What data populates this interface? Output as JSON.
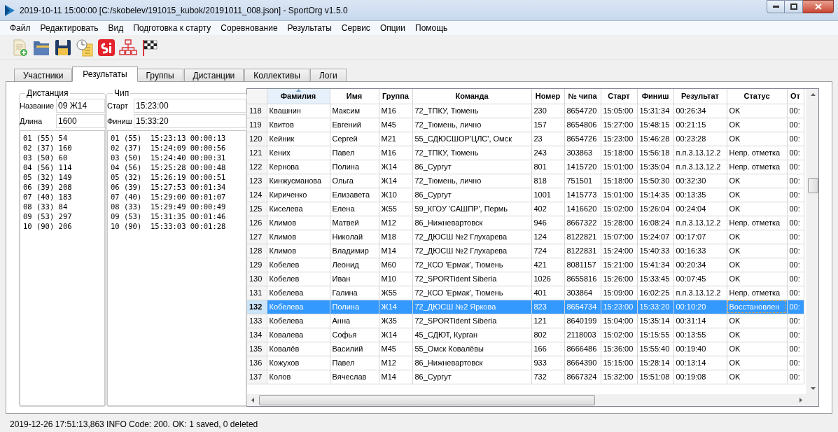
{
  "window": {
    "title": "2019-10-11 15:00:00 [C:/skobelev/191015_kubok/20191011_008.json] - SportOrg v1.5.0"
  },
  "menu": [
    "Файл",
    "Редактировать",
    "Вид",
    "Подготовка к старту",
    "Соревнование",
    "Результаты",
    "Сервис",
    "Опции",
    "Помощь"
  ],
  "tabs": [
    {
      "label": "Участники",
      "selected": false
    },
    {
      "label": "Результаты",
      "selected": true
    },
    {
      "label": "Группы",
      "selected": false
    },
    {
      "label": "Дистанции",
      "selected": false
    },
    {
      "label": "Коллективы",
      "selected": false
    },
    {
      "label": "Логи",
      "selected": false
    }
  ],
  "distance": {
    "legend": "Дистанция",
    "fields": [
      {
        "label": "Название",
        "value": "09 Ж14"
      },
      {
        "label": "Длина",
        "value": "1600"
      }
    ],
    "splits": [
      "01 (55) 54",
      "02 (37) 160",
      "03 (50) 60",
      "04 (56) 114",
      "05 (32) 149",
      "06 (39) 208",
      "07 (40) 183",
      "08 (33) 84",
      "09 (53) 297",
      "10 (90) 206"
    ]
  },
  "chip": {
    "legend": "Чип",
    "fields": [
      {
        "label": "Старт",
        "value": "15:23:00"
      },
      {
        "label": "Финиш",
        "value": "15:33:20"
      }
    ],
    "splits": [
      "01 (55)  15:23:13 00:00:13",
      "02 (37)  15:24:09 00:00:56",
      "03 (50)  15:24:40 00:00:31",
      "04 (56)  15:25:28 00:00:48",
      "05 (32)  15:26:19 00:00:51",
      "06 (39)  15:27:53 00:01:34",
      "07 (40)  15:29:00 00:01:07",
      "08 (33)  15:29:49 00:00:49",
      "09 (53)  15:31:35 00:01:46",
      "10 (90)  15:33:03 00:01:28"
    ]
  },
  "table": {
    "columns": [
      {
        "label": "Фамилия",
        "sorted": true
      },
      {
        "label": "Имя",
        "sorted": false
      },
      {
        "label": "Группа",
        "sorted": false
      },
      {
        "label": "Команда",
        "sorted": false
      },
      {
        "label": "Номер",
        "sorted": false
      },
      {
        "label": "№ чипа",
        "sorted": false
      },
      {
        "label": "Старт",
        "sorted": false
      },
      {
        "label": "Финиш",
        "sorted": false
      },
      {
        "label": "Результат",
        "sorted": false
      },
      {
        "label": "Статус",
        "sorted": false
      },
      {
        "label": "От",
        "sorted": false
      }
    ],
    "rows": [
      {
        "number": "118",
        "selected": false,
        "cells": [
          "Квашнин",
          "Максим",
          "М16",
          "72_ТПКУ, Тюмень",
          "230",
          "8654720",
          "15:05:00",
          "15:31:34",
          "00:26:34",
          "OK",
          "00:"
        ]
      },
      {
        "number": "119",
        "selected": false,
        "cells": [
          "Квитов",
          "Евгений",
          "М45",
          "72_Тюмень, лично",
          "157",
          "8654806",
          "15:27:00",
          "15:48:15",
          "00:21:15",
          "OK",
          "00:"
        ]
      },
      {
        "number": "120",
        "selected": false,
        "cells": [
          "Кейник",
          "Сергей",
          "М21",
          "55_СДЮСШОР'ЦЛС', Омск",
          "23",
          "8654726",
          "15:23:00",
          "15:46:28",
          "00:23:28",
          "OK",
          "00:"
        ]
      },
      {
        "number": "121",
        "selected": false,
        "cells": [
          "Кених",
          "Павел",
          "М16",
          "72_ТПКУ, Тюмень",
          "243",
          "303863",
          "15:18:00",
          "15:56:18",
          "п.п.3.13.12.2",
          "Непр. отметка",
          "00:"
        ]
      },
      {
        "number": "122",
        "selected": false,
        "cells": [
          "Кернова",
          "Полина",
          "Ж14",
          "86_Сургут",
          "801",
          "1415720",
          "15:01:00",
          "15:35:04",
          "п.п.3.13.12.2",
          "Непр. отметка",
          "00:"
        ]
      },
      {
        "number": "123",
        "selected": false,
        "cells": [
          "Кинжусманова",
          "Ольга",
          "Ж14",
          "72_Тюмень, лично",
          "818",
          "751501",
          "15:18:00",
          "15:50:30",
          "00:32:30",
          "OK",
          "00:"
        ]
      },
      {
        "number": "124",
        "selected": false,
        "cells": [
          "Кириченко",
          "Елизавета",
          "Ж10",
          "86_Сургут",
          "1001",
          "1415773",
          "15:01:00",
          "15:14:35",
          "00:13:35",
          "OK",
          "00:"
        ]
      },
      {
        "number": "125",
        "selected": false,
        "cells": [
          "Киселева",
          "Елена",
          "Ж55",
          "59_КГОУ 'САШПР', Пермь",
          "402",
          "1416620",
          "15:02:00",
          "15:26:04",
          "00:24:04",
          "OK",
          "00:"
        ]
      },
      {
        "number": "126",
        "selected": false,
        "cells": [
          "Климов",
          "Матвей",
          "М12",
          "86_Нижневартовск",
          "946",
          "8667322",
          "15:28:00",
          "16:08:24",
          "п.п.3.13.12.2",
          "Непр. отметка",
          "00:"
        ]
      },
      {
        "number": "127",
        "selected": false,
        "cells": [
          "Климов",
          "Николай",
          "М18",
          "72_ДЮСШ №2  Глухарева",
          "124",
          "8122821",
          "15:07:00",
          "15:24:07",
          "00:17:07",
          "OK",
          "00:"
        ]
      },
      {
        "number": "128",
        "selected": false,
        "cells": [
          "Климов",
          "Владимир",
          "М14",
          "72_ДЮСШ №2  Глухарева",
          "724",
          "8122831",
          "15:24:00",
          "15:40:33",
          "00:16:33",
          "OK",
          "00:"
        ]
      },
      {
        "number": "129",
        "selected": false,
        "cells": [
          "Кобелев",
          "Леонид",
          "М60",
          "72_КСО 'Ермак', Тюмень",
          "421",
          "8081157",
          "15:21:00",
          "15:41:34",
          "00:20:34",
          "OK",
          "00:"
        ]
      },
      {
        "number": "130",
        "selected": false,
        "cells": [
          "Кобелев",
          "Иван",
          "М10",
          "72_SPORTident Siberia",
          "1026",
          "8655816",
          "15:26:00",
          "15:33:45",
          "00:07:45",
          "OK",
          "00:"
        ]
      },
      {
        "number": "131",
        "selected": false,
        "cells": [
          "Кобелева",
          "Галина",
          "Ж55",
          "72_КСО 'Ермак', Тюмень",
          "401",
          "303864",
          "15:09:00",
          "16:02:25",
          "п.п.3.13.12.2",
          "Непр. отметка",
          "00:"
        ]
      },
      {
        "number": "132",
        "selected": true,
        "cells": [
          "Кобелева",
          "Полина",
          "Ж14",
          "72_ДЮСШ №2 Яркова",
          "823",
          "8654734",
          "15:23:00",
          "15:33:20",
          "00:10:20",
          "Восстановлен",
          "00:"
        ]
      },
      {
        "number": "133",
        "selected": false,
        "cells": [
          "Кобелева",
          "Анна",
          "Ж35",
          "72_SPORTident Siberia",
          "121",
          "8640199",
          "15:04:00",
          "15:35:14",
          "00:31:14",
          "OK",
          "00:"
        ]
      },
      {
        "number": "134",
        "selected": false,
        "cells": [
          "Ковалева",
          "Софья",
          "Ж14",
          "45_СДЮТ, Курган",
          "802",
          "2118003",
          "15:02:00",
          "15:15:55",
          "00:13:55",
          "OK",
          "00:"
        ]
      },
      {
        "number": "135",
        "selected": false,
        "cells": [
          "Ковалёв",
          "Василий",
          "М45",
          "55_Омск Ковалёвы",
          "166",
          "8666486",
          "15:36:00",
          "15:55:40",
          "00:19:40",
          "OK",
          "00:"
        ]
      },
      {
        "number": "136",
        "selected": false,
        "cells": [
          "Кожухов",
          "Павел",
          "М12",
          "86_Нижневартовск",
          "933",
          "8664390",
          "15:15:00",
          "15:28:14",
          "00:13:14",
          "OK",
          "00:"
        ]
      },
      {
        "number": "137",
        "selected": false,
        "cells": [
          "Колов",
          "Вячеслав",
          "М14",
          "86_Сургут",
          "732",
          "8667324",
          "15:32:00",
          "15:51:08",
          "00:19:08",
          "OK",
          "00:"
        ]
      }
    ]
  },
  "status_bar": "2019-12-26 17:51:13,863 INFO Code: 200. OK: 1 saved, 0 deleted"
}
